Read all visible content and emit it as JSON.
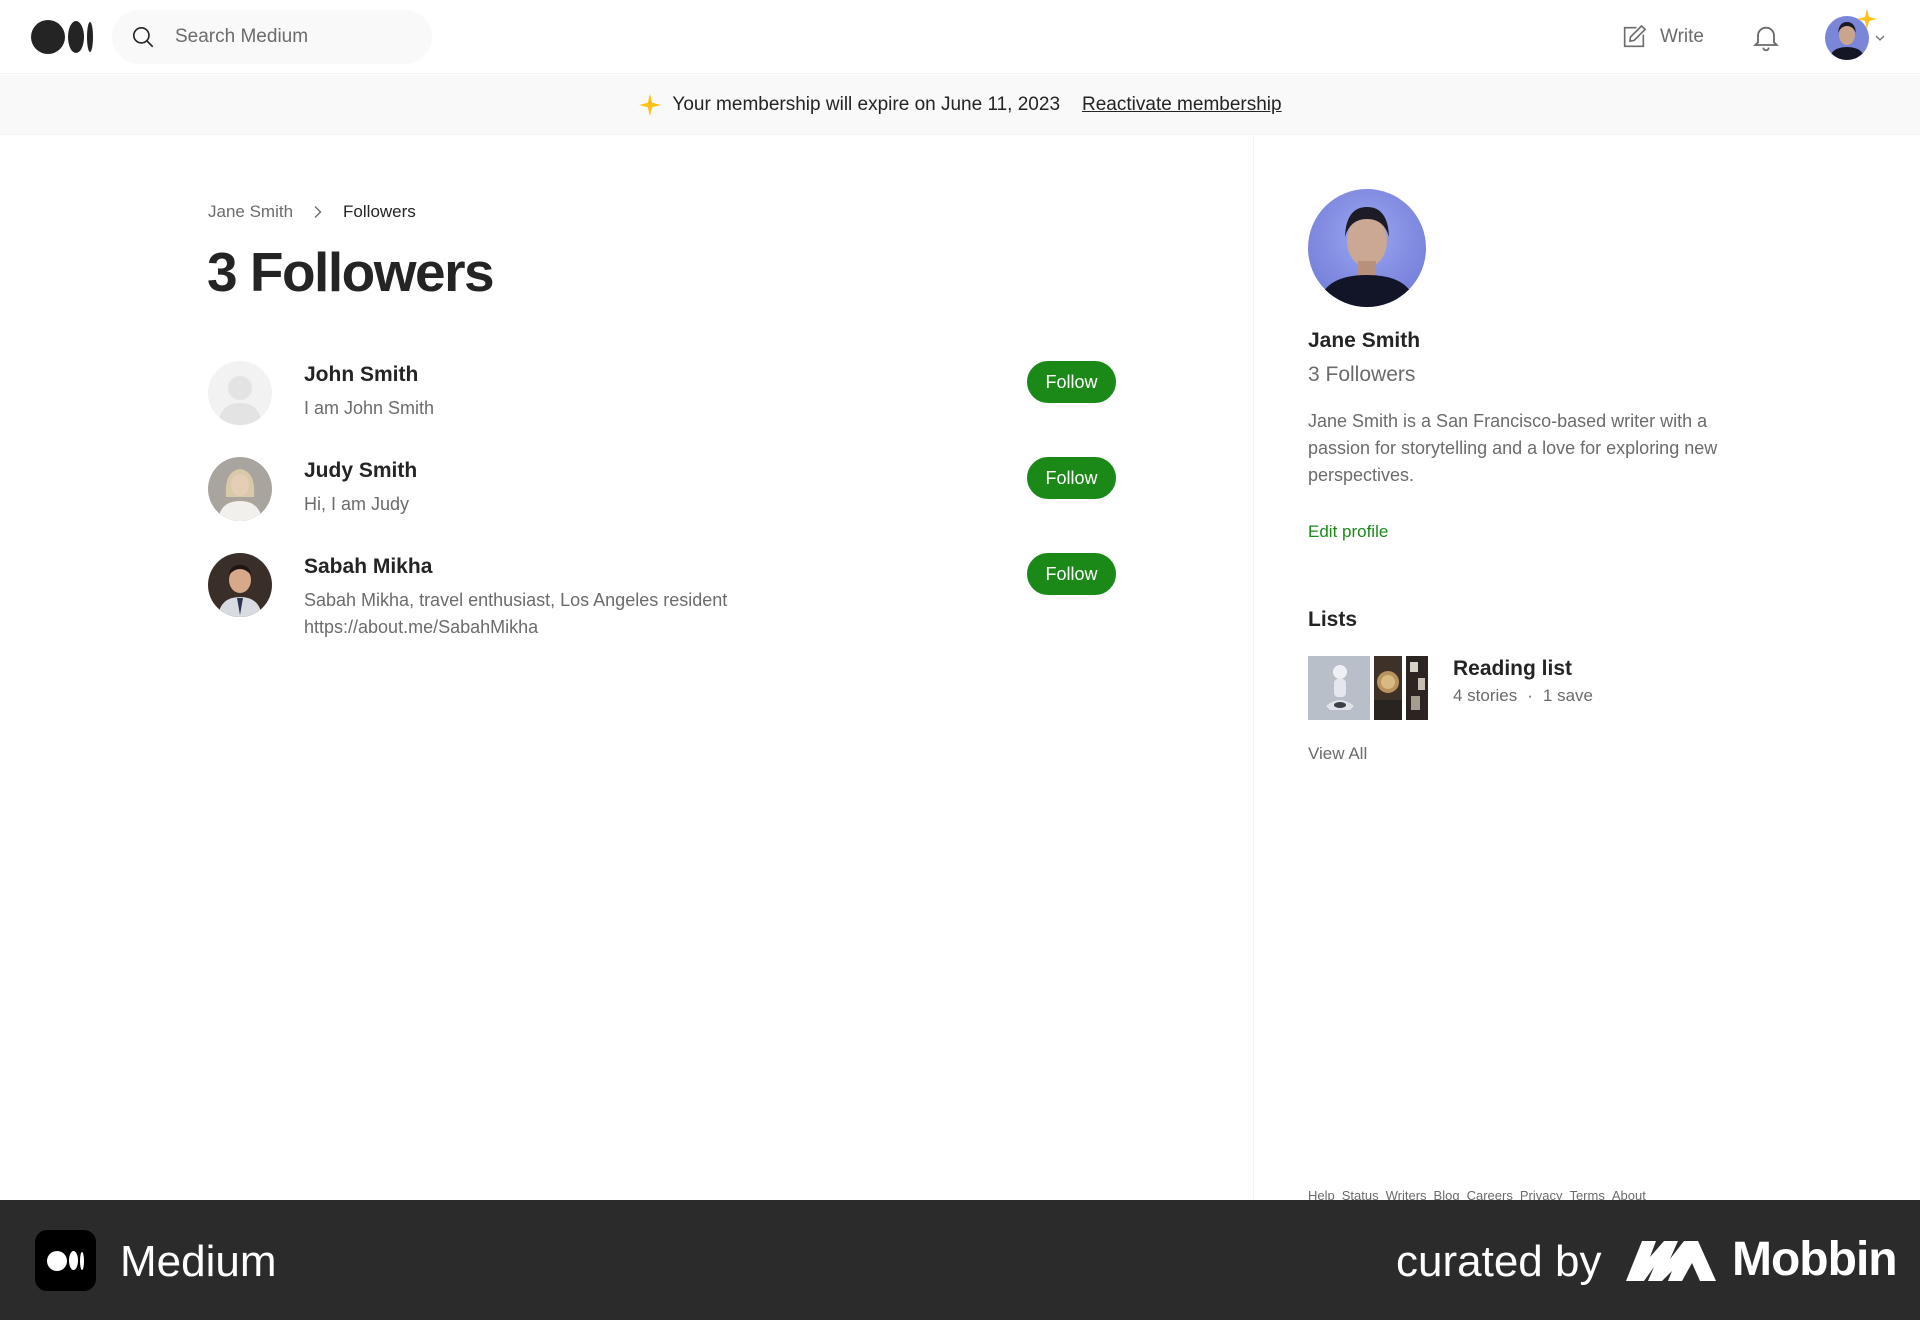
{
  "navbar": {
    "search_placeholder": "Search Medium",
    "write_label": "Write"
  },
  "banner": {
    "message": "Your membership will expire on June 11, 2023",
    "action": "Reactivate membership"
  },
  "breadcrumb": {
    "parent": "Jane Smith",
    "current": "Followers"
  },
  "page_title": "3 Followers",
  "followers": [
    {
      "name": "John Smith",
      "bio": "I am John Smith",
      "button": "Follow"
    },
    {
      "name": "Judy Smith",
      "bio": "Hi, I am Judy",
      "button": "Follow"
    },
    {
      "name": "Sabah Mikha",
      "bio": "Sabah Mikha, travel enthusiast, Los Angeles resident https://about.me/SabahMikha",
      "button": "Follow"
    }
  ],
  "profile": {
    "name": "Jane Smith",
    "followers": "3 Followers",
    "bio": "Jane Smith is a San Francisco-based writer with a passion for storytelling and a love for exploring new perspectives.",
    "edit_label": "Edit profile"
  },
  "lists": {
    "heading": "Lists",
    "items": [
      {
        "title": "Reading list",
        "stories": "4 stories",
        "separator": "·",
        "saves": "1 save"
      }
    ],
    "view_all": "View All"
  },
  "footer_links": [
    "Help",
    "Status",
    "Writers",
    "Blog",
    "Careers",
    "Privacy",
    "Terms",
    "About"
  ],
  "bottom_strip": {
    "app_name": "Medium",
    "curated_by": "curated by",
    "brand": "Mobbin"
  },
  "colors": {
    "accent_green": "#1a8917",
    "text_primary": "#242424",
    "text_secondary": "#6b6b6b",
    "sparkle_gold": "#ffc017"
  },
  "icons": [
    "medium-logo-icon",
    "search-icon",
    "write-icon",
    "bell-icon",
    "sparkle-icon",
    "chevron-down-icon",
    "chevron-right-icon",
    "mobbin-logo-icon"
  ]
}
